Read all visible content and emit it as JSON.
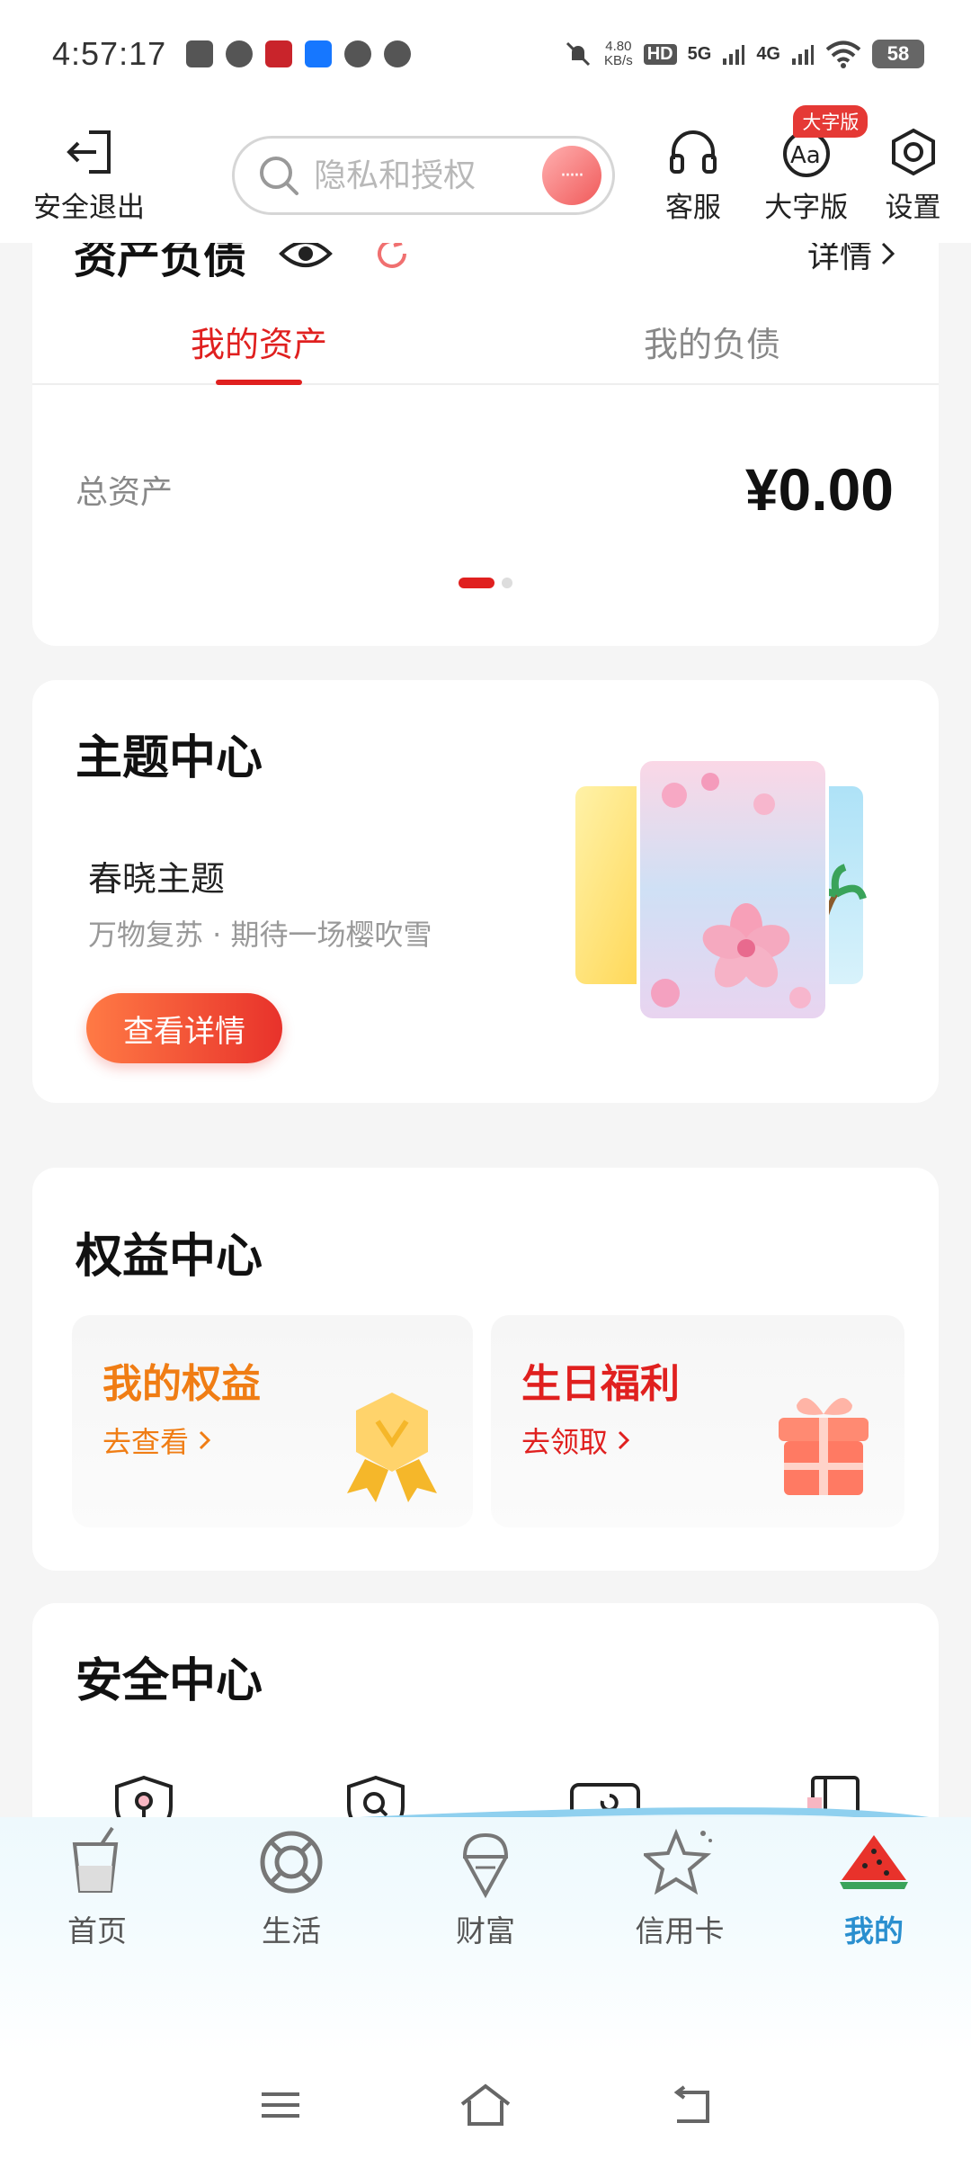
{
  "status_bar": {
    "time": "4:57:17",
    "speed_value": "4.80",
    "speed_unit": "KB/s",
    "hd": "HD",
    "net1": "5G",
    "net2": "4G",
    "battery": "58"
  },
  "header": {
    "exit_label": "安全退出",
    "search_placeholder": "隐私和授权",
    "voice_dots": "·····",
    "service_label": "客服",
    "bigfont_label": "大字版",
    "bigfont_badge": "大字版",
    "settings_label": "设置"
  },
  "assets": {
    "title": "资产负债",
    "details": "详情",
    "tabs": [
      {
        "label": "我的资产",
        "active": true
      },
      {
        "label": "我的负债",
        "active": false
      }
    ],
    "total_label": "总资产",
    "total_value": "¥0.00"
  },
  "theme": {
    "title": "主题中心",
    "name": "春晓主题",
    "desc": "万物复苏 · 期待一场樱吹雪",
    "button": "查看详情"
  },
  "benefits": {
    "title": "权益中心",
    "items": [
      {
        "title": "我的权益",
        "link": "去查看",
        "icon": "medal-icon"
      },
      {
        "title": "生日福利",
        "link": "去领取",
        "icon": "gift-icon"
      }
    ]
  },
  "security": {
    "title": "安全中心"
  },
  "bottom_nav": {
    "items": [
      {
        "label": "首页",
        "icon": "cup-icon"
      },
      {
        "label": "生活",
        "icon": "lifebuoy-icon"
      },
      {
        "label": "财富",
        "icon": "icecream-icon"
      },
      {
        "label": "信用卡",
        "icon": "starfish-icon"
      },
      {
        "label": "我的",
        "icon": "watermelon-icon",
        "active": true
      }
    ]
  },
  "colors": {
    "accent_red": "#e0201f",
    "orange": "#f07d14",
    "nav_active": "#2a8fcf"
  }
}
